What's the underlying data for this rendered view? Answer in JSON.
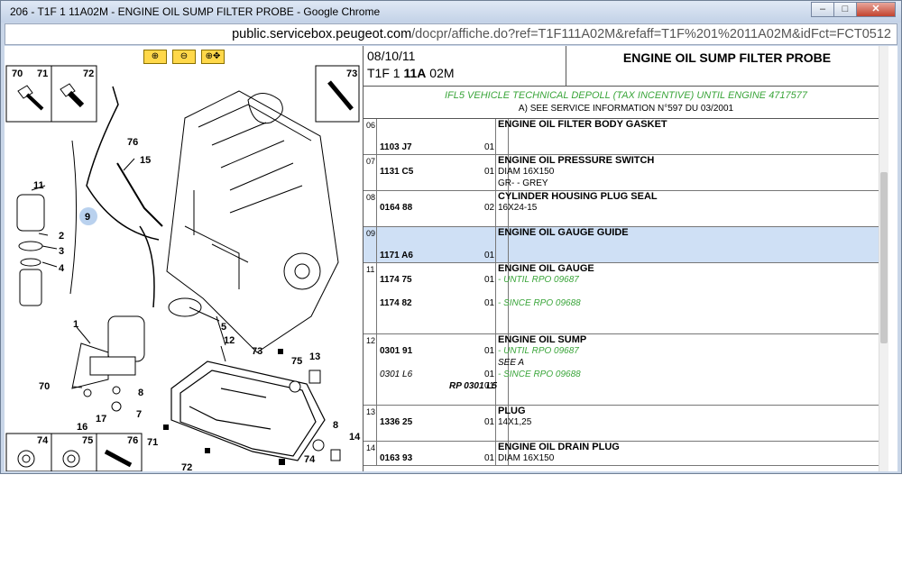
{
  "window": {
    "title": "206 - T1F 1 11A02M - ENGINE OIL SUMP FILTER PROBE - Google Chrome",
    "buttons": {
      "minimize": "–",
      "maximize": "□",
      "close": "✕"
    }
  },
  "address": {
    "host": "public.servicebox.peugeot.com",
    "path": "/docpr/affiche.do?ref=T1F111A02M&refaff=T1F%201%2011A02M&idFct=FCT0512"
  },
  "diagram": {
    "zoom_buttons": [
      "zoom-in-icon",
      "zoom-out-icon",
      "zoom-fit-icon"
    ],
    "labels": {
      "l70": "70",
      "l71": "71",
      "l72": "72",
      "l73": "73",
      "l76": "76",
      "l15": "15",
      "l11": "11",
      "l9": "9",
      "l2": "2",
      "l3": "3",
      "l4": "4",
      "l1": "1",
      "l5": "5",
      "l12": "12",
      "l73b": "73",
      "l75": "75",
      "l13": "13",
      "l70b": "70",
      "l8": "8",
      "l7": "7",
      "l16": "16",
      "l17": "17",
      "l71b": "71",
      "l72b": "72",
      "l8b": "8",
      "l14": "14",
      "l74": "74",
      "b74": "74",
      "b75": "75",
      "b76": "76"
    }
  },
  "header": {
    "date": "08/10/11",
    "ref_prefix": "T1F 1 ",
    "ref_bold": "11A",
    "ref_suffix": " 02M",
    "title": "ENGINE OIL SUMP FILTER PROBE"
  },
  "notes": {
    "line1": "IFL5 VEHICLE TECHNICAL DEPOLL (TAX INCENTIVE) UNTIL ENGINE 4717577",
    "line2": "A) SEE SERVICE INFORMATION N°597 DU 03/2001"
  },
  "rows": [
    {
      "num": "06",
      "lines": [
        {
          "ref": "",
          "qty": "",
          "desc": "ENGINE OIL FILTER BODY GASKET",
          "style": "title"
        },
        {
          "ref": "",
          "qty": "",
          "desc": "",
          "style": ""
        },
        {
          "ref": "1103 J7",
          "qty": "01",
          "desc": "",
          "style": ""
        }
      ]
    },
    {
      "num": "07",
      "lines": [
        {
          "ref": "",
          "qty": "",
          "desc": "ENGINE OIL PRESSURE SWITCH",
          "style": "title"
        },
        {
          "ref": "1131 C5",
          "qty": "01",
          "desc": "DIAM 16X150",
          "style": ""
        },
        {
          "ref": "",
          "qty": "",
          "desc": "GR- - GREY",
          "style": ""
        }
      ]
    },
    {
      "num": "08",
      "lines": [
        {
          "ref": "",
          "qty": "",
          "desc": "CYLINDER HOUSING PLUG SEAL",
          "style": "title"
        },
        {
          "ref": "0164 88",
          "qty": "02",
          "desc": "16X24-15",
          "style": ""
        },
        {
          "ref": "",
          "qty": "",
          "desc": "",
          "style": ""
        }
      ]
    },
    {
      "num": "09",
      "selected": true,
      "lines": [
        {
          "ref": "",
          "qty": "",
          "desc": "ENGINE OIL GAUGE GUIDE",
          "style": "title"
        },
        {
          "ref": "",
          "qty": "",
          "desc": "",
          "style": ""
        },
        {
          "ref": "1171 A6",
          "qty": "01",
          "desc": "",
          "style": ""
        }
      ]
    },
    {
      "num": "11",
      "lines": [
        {
          "ref": "",
          "qty": "",
          "desc": "ENGINE OIL GAUGE",
          "style": "title"
        },
        {
          "ref": "1174 75",
          "qty": "01",
          "desc": "- UNTIL RPO 09687",
          "style": "green"
        },
        {
          "ref": "",
          "qty": "",
          "desc": "",
          "style": ""
        },
        {
          "ref": "1174 82",
          "qty": "01",
          "desc": "- SINCE RPO 09688",
          "style": "green"
        },
        {
          "ref": "",
          "qty": "",
          "desc": "",
          "style": ""
        },
        {
          "ref": "",
          "qty": "",
          "desc": "",
          "style": ""
        }
      ]
    },
    {
      "num": "12",
      "lines": [
        {
          "ref": "",
          "qty": "",
          "desc": "ENGINE OIL SUMP",
          "style": "title"
        },
        {
          "ref": "0301 91",
          "qty": "01",
          "desc": "- UNTIL RPO 09687",
          "style": "green"
        },
        {
          "ref": "",
          "qty": "",
          "desc": "SEE A",
          "style": "italic"
        },
        {
          "ref": "0301 L6",
          "refstyle": "it",
          "qty": "01",
          "desc": "- SINCE RPO 09688",
          "style": "green"
        },
        {
          "rp": "RP 0301 L5",
          "ref": "",
          "qty": "01",
          "desc": "",
          "style": ""
        },
        {
          "ref": "",
          "qty": "",
          "desc": "",
          "style": ""
        }
      ]
    },
    {
      "num": "13",
      "lines": [
        {
          "ref": "",
          "qty": "",
          "desc": "PLUG",
          "style": "title"
        },
        {
          "ref": "1336 25",
          "qty": "01",
          "desc": "14X1,25",
          "style": ""
        },
        {
          "ref": "",
          "qty": "",
          "desc": "",
          "style": ""
        }
      ]
    },
    {
      "num": "14",
      "lines": [
        {
          "ref": "",
          "qty": "",
          "desc": "ENGINE OIL DRAIN PLUG",
          "style": "title"
        },
        {
          "ref": "0163 93",
          "qty": "01",
          "desc": "DIAM 16X150",
          "style": ""
        }
      ]
    }
  ]
}
